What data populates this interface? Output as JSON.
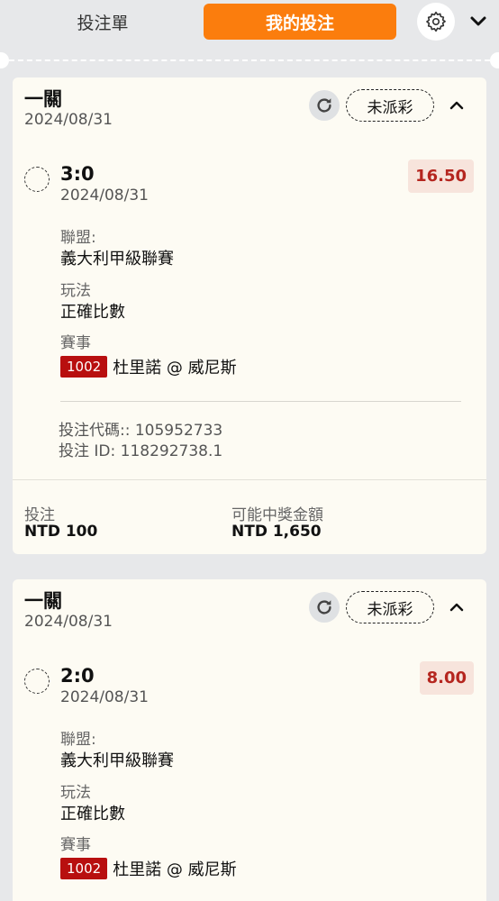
{
  "header": {
    "tab_betslip": "投注單",
    "tab_mybets": "我的投注",
    "gear_icon": "gear-icon",
    "collapse_icon": "chevron-down-icon"
  },
  "colors": {
    "accent": "#fb7d0d",
    "odds_text": "#b5261f",
    "event_code_bg": "#b80f0f"
  },
  "bets": [
    {
      "title": "一關",
      "date": "2024/08/31",
      "status": "未派彩",
      "selection": "3:0",
      "selection_date": "2024/08/31",
      "odds": "16.50",
      "league_label": "聯盟:",
      "league": "義大利甲級聯賽",
      "market_label": "玩法",
      "market": "正確比數",
      "event_label": "賽事",
      "event_code": "1002",
      "event": "杜里諾 @ 威尼斯",
      "bet_code": "投注代碼:: 105952733",
      "bet_id": "投注 ID: 118292738.1",
      "stake_label": "投注",
      "stake": "NTD 100",
      "return_label": "可能中獎金額",
      "return": "NTD 1,650"
    },
    {
      "title": "一關",
      "date": "2024/08/31",
      "status": "未派彩",
      "selection": "2:0",
      "selection_date": "2024/08/31",
      "odds": "8.00",
      "league_label": "聯盟:",
      "league": "義大利甲級聯賽",
      "market_label": "玩法",
      "market": "正確比數",
      "event_label": "賽事",
      "event_code": "1002",
      "event": "杜里諾 @ 威尼斯"
    }
  ]
}
